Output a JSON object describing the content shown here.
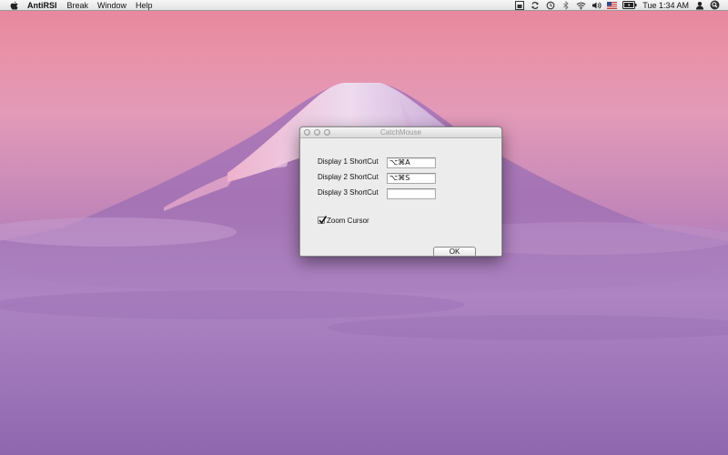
{
  "menubar": {
    "app_name": "AntiRSI",
    "menus": [
      "Break",
      "Window",
      "Help"
    ],
    "clock": "Tue 1:34 AM",
    "status_icons": [
      "antirsi-status-icon",
      "sync-icon",
      "time-machine-icon",
      "bluetooth-icon",
      "wifi-icon",
      "volume-icon",
      "flag-icon",
      "battery-icon",
      "spotlight-icon",
      "user-icon"
    ]
  },
  "window": {
    "title": "CatchMouse",
    "rows": [
      {
        "label": "Display 1 ShortCut",
        "value": "⌥⌘A"
      },
      {
        "label": "Display 2 ShortCut",
        "value": "⌥⌘S"
      },
      {
        "label": "Display 3 ShortCut",
        "value": ""
      }
    ],
    "zoom_cursor_label": "Zoom Cursor",
    "zoom_cursor_checked": true,
    "ok_label": "OK"
  },
  "colors": {
    "sky_top": "#e6869c",
    "sky_mid": "#d08fb9",
    "lower": "#8a62ad",
    "mountain": "#9a6fb4",
    "window_bg": "#ececec"
  }
}
